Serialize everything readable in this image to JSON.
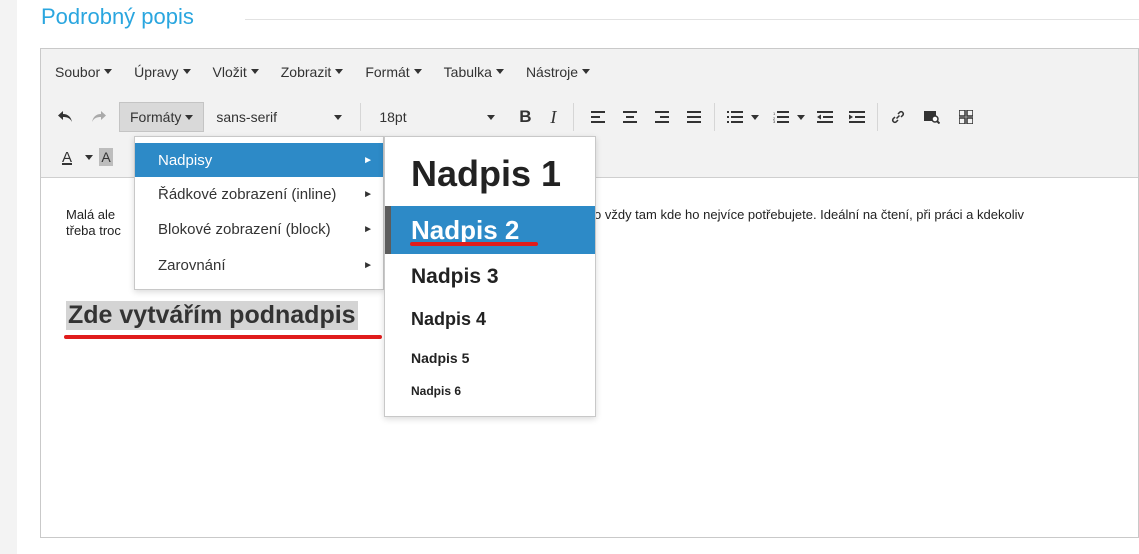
{
  "section": {
    "title": "Podrobný popis"
  },
  "menubar": {
    "items": [
      "Soubor",
      "Úpravy",
      "Vložit",
      "Zobrazit",
      "Formát",
      "Tabulka",
      "Nástroje"
    ]
  },
  "toolbar": {
    "formats_label": "Formáty",
    "font_family": "sans-serif",
    "font_size": "18pt",
    "bold_label": "B",
    "italic_label": "I",
    "font_color_label": "A",
    "bg_color_label": "A"
  },
  "dropdown": {
    "items": [
      {
        "label": "Nadpisy",
        "active": true
      },
      {
        "label": "Řádkové zobrazení (inline)",
        "active": false
      },
      {
        "label": "Blokové zobrazení (block)",
        "active": false
      },
      {
        "label": "Zarovnání",
        "active": false
      }
    ]
  },
  "submenu": {
    "items": [
      "Nadpis 1",
      "Nadpis 2",
      "Nadpis 3",
      "Nadpis 4",
      "Nadpis 5",
      "Nadpis 6"
    ],
    "active_index": 1
  },
  "content": {
    "paragraph_line1": "Malá ale",
    "paragraph_line2": "třeba troc",
    "paragraph_rest": "o vždy tam kde ho nejvíce potřebujete. Ideální na čtení, při práci a kdekoliv",
    "subheading": "Zde vytvářím podnadpis"
  },
  "colors": {
    "accent": "#2d8ac7",
    "title": "#2aa6df",
    "underline": "#e01c1c"
  }
}
